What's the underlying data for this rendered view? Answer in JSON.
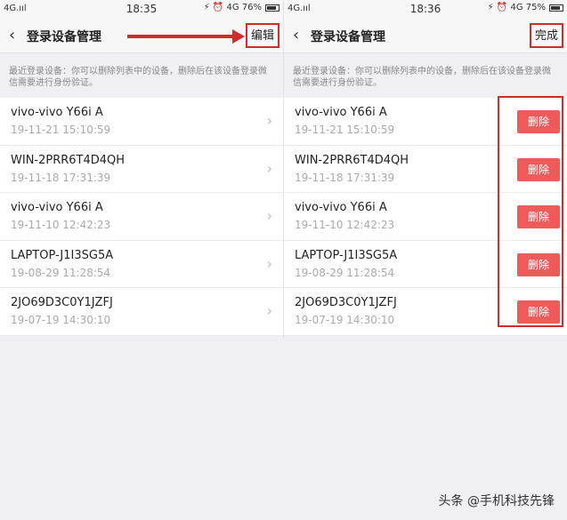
{
  "left": {
    "status": {
      "signal": "4G.ııl",
      "time": "18:35",
      "icons": "⚡ ⏰ 4G 76%"
    },
    "nav": {
      "title": "登录设备管理",
      "action": "编辑"
    },
    "hint": "最近登录设备：你可以删除列表中的设备，删除后在该设备登录微信需要进行身份验证。",
    "items": [
      {
        "name": "vivo-vivo Y66i A",
        "time": "19-11-21 15:10:59"
      },
      {
        "name": "WIN-2PRR6T4D4QH",
        "time": "19-11-18 17:31:39"
      },
      {
        "name": "vivo-vivo Y66i A",
        "time": "19-11-10 12:42:23"
      },
      {
        "name": "LAPTOP-J1I3SG5A",
        "time": "19-08-29 11:28:54"
      },
      {
        "name": "2JO69D3C0Y1JZFJ",
        "time": "19-07-19 14:30:10"
      }
    ]
  },
  "right": {
    "status": {
      "signal": "4G.ııl",
      "time": "18:36",
      "icons": "⚡ ⏰ 4G 75%"
    },
    "nav": {
      "title": "登录设备管理",
      "action": "完成"
    },
    "hint": "最近登录设备：你可以删除列表中的设备，删除后在该设备登录微信需要进行身份验证。",
    "delete_label": "删除",
    "items": [
      {
        "name": "vivo-vivo Y66i A",
        "time": "19-11-21 15:10:59"
      },
      {
        "name": "WIN-2PRR6T4D4QH",
        "time": "19-11-18 17:31:39"
      },
      {
        "name": "vivo-vivo Y66i A",
        "time": "19-11-10 12:42:23"
      },
      {
        "name": "LAPTOP-J1I3SG5A",
        "time": "19-08-29 11:28:54"
      },
      {
        "name": "2JO69D3C0Y1JZFJ",
        "time": "19-07-19 14:30:10"
      }
    ]
  },
  "watermark": "头条 @手机科技先锋",
  "colors": {
    "accent_red": "#d42a2a",
    "delete_button": "#ef5b5b"
  }
}
